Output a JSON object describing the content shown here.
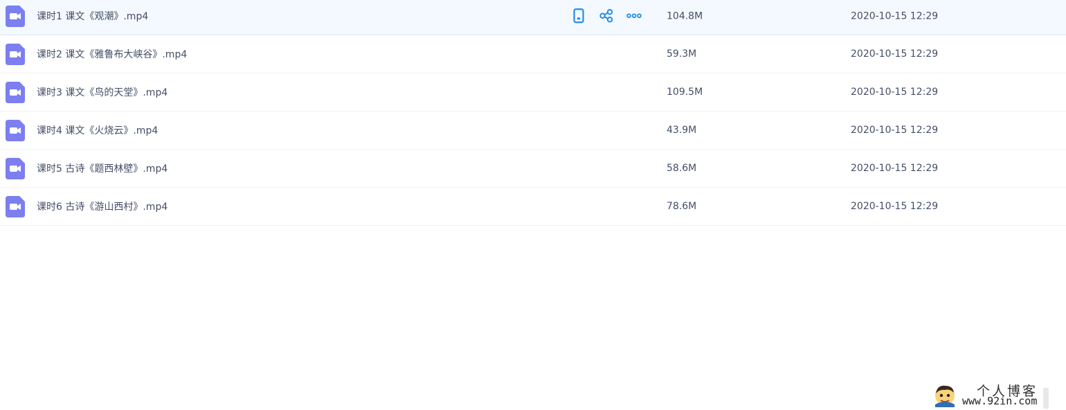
{
  "files": [
    {
      "name": "课时1 课文《观潮》.mp4",
      "size": "104.8M",
      "date": "2020-10-15 12:29",
      "icon": "video-file-icon"
    },
    {
      "name": "课时2 课文《雅鲁布大峡谷》.mp4",
      "size": "59.3M",
      "date": "2020-10-15 12:29",
      "icon": "video-file-icon"
    },
    {
      "name": "课时3 课文《鸟的天堂》.mp4",
      "size": "109.5M",
      "date": "2020-10-15 12:29",
      "icon": "video-file-icon"
    },
    {
      "name": "课时4 课文《火烧云》.mp4",
      "size": "43.9M",
      "date": "2020-10-15 12:29",
      "icon": "video-file-icon"
    },
    {
      "name": "课时5 古诗《题西林壁》.mp4",
      "size": "58.6M",
      "date": "2020-10-15 12:29",
      "icon": "video-file-icon"
    },
    {
      "name": "课时6 古诗《游山西村》.mp4",
      "size": "78.6M",
      "date": "2020-10-15 12:29",
      "icon": "video-file-icon"
    }
  ],
  "row_actions": {
    "phone": "phone-icon",
    "share": "share-icon",
    "more": "more-icon"
  },
  "colors": {
    "icon_purple": "#7b7ff0",
    "action_blue": "#1f8ceb",
    "text": "#424e67",
    "hover_row": "#f4f9ff"
  },
  "watermark": {
    "title": "个人博客",
    "url": "www.92in.com"
  }
}
